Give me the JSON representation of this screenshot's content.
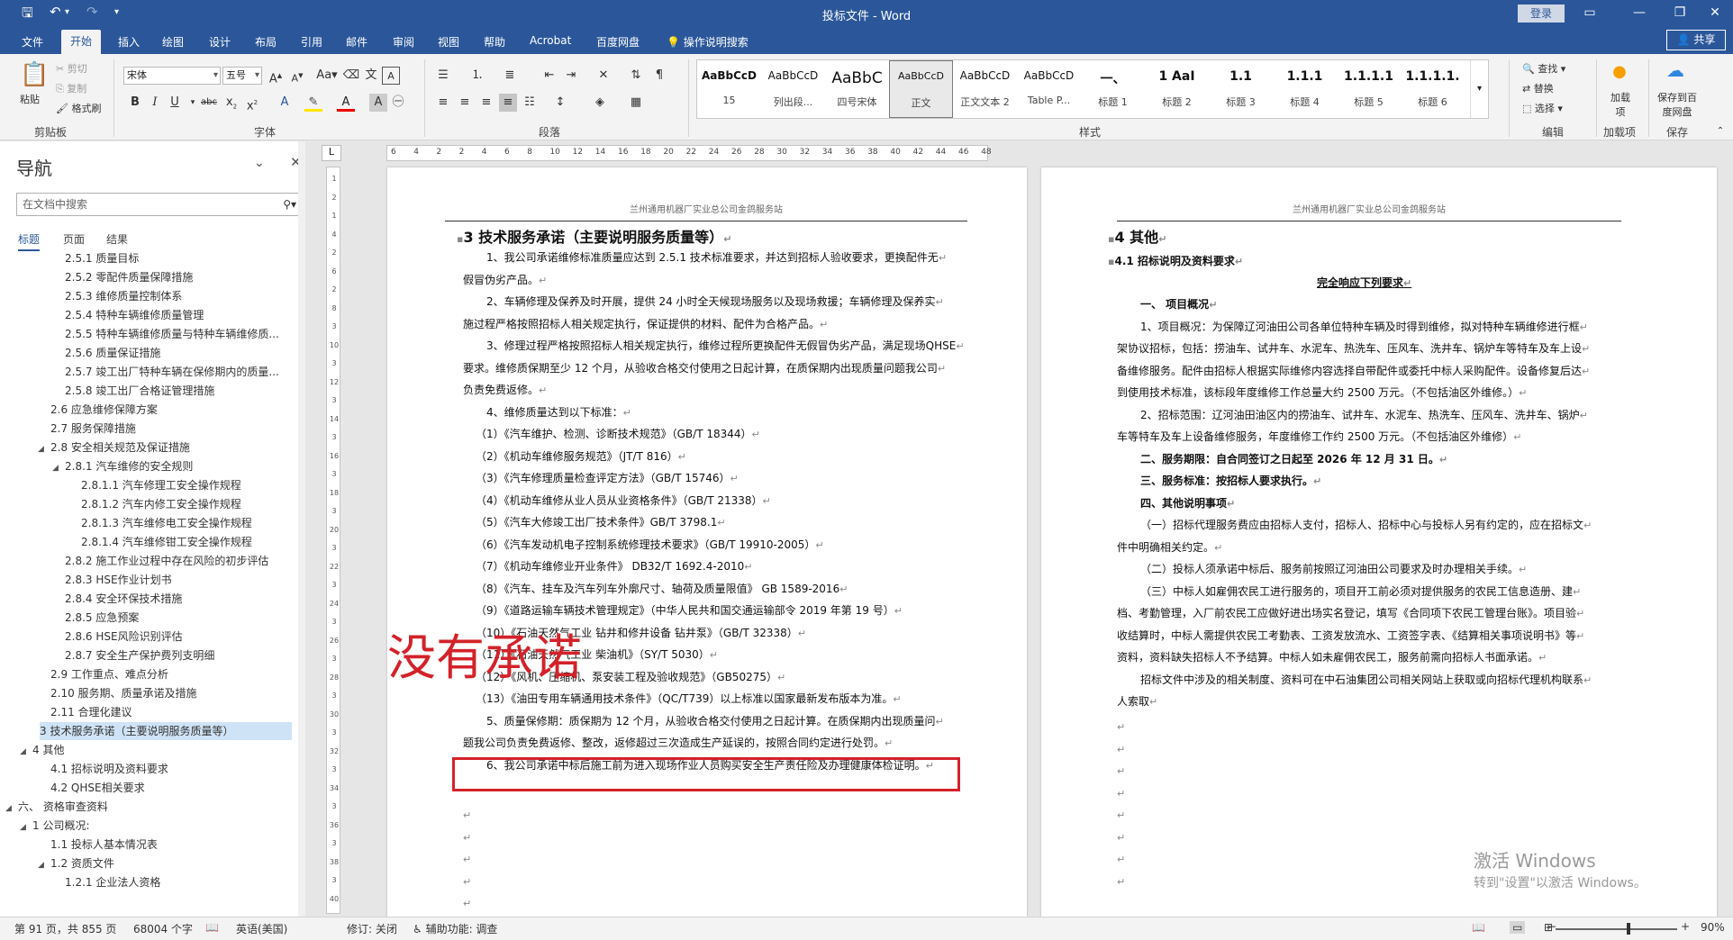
{
  "app": {
    "title": "投标文件  -  Word",
    "login": "登录",
    "share": "共享"
  },
  "tabs": [
    "文件",
    "开始",
    "插入",
    "绘图",
    "设计",
    "布局",
    "引用",
    "邮件",
    "审阅",
    "视图",
    "帮助",
    "Acrobat",
    "百度网盘"
  ],
  "tell_me": "操作说明搜索",
  "ribbon": {
    "clipboard": {
      "paste": "粘贴",
      "cut": "剪切",
      "copy": "复制",
      "format_painter": "格式刷",
      "label": "剪贴板"
    },
    "font": {
      "name": "宋体",
      "size": "五号",
      "label": "字体"
    },
    "paragraph": {
      "label": "段落"
    },
    "styles": {
      "label": "样式",
      "items": [
        {
          "preview": "AaBbCcD",
          "name": "15"
        },
        {
          "preview": "AaBbCcD",
          "name": "列出段..."
        },
        {
          "preview": "AaBbC",
          "name": "四号宋体"
        },
        {
          "preview": "AaBbCcD",
          "name": "正文"
        },
        {
          "preview": "AaBbCcD",
          "name": "正文文本 2"
        },
        {
          "preview": "AaBbCcD",
          "name": "Table P..."
        },
        {
          "preview": "一、",
          "name": "标题 1"
        },
        {
          "preview": "1  AaI",
          "name": "标题 2"
        },
        {
          "preview": "1.1",
          "name": "标题 3"
        },
        {
          "preview": "1.1.1",
          "name": "标题 4"
        },
        {
          "preview": "1.1.1.1",
          "name": "标题 5"
        },
        {
          "preview": "1.1.1.1.",
          "name": "标题 6"
        }
      ]
    },
    "editing": {
      "find": "查找",
      "replace": "替换",
      "select": "选择",
      "label": "编辑"
    },
    "addins": {
      "load": "加载项",
      "label": "加载项"
    },
    "save": {
      "save": "保存到百度网盘",
      "label": "保存"
    }
  },
  "nav": {
    "title": "导航",
    "search_placeholder": "在文档中搜索",
    "tabs": [
      "标题",
      "页面",
      "结果"
    ],
    "items": [
      {
        "text": "2.5.1 质量目标",
        "level": 3,
        "tri": ""
      },
      {
        "text": "2.5.2 零配件质量保障措施",
        "level": 3,
        "tri": ""
      },
      {
        "text": "2.5.3 维修质量控制体系",
        "level": 3,
        "tri": ""
      },
      {
        "text": "2.5.4 特种车辆维修质量管理",
        "level": 3,
        "tri": ""
      },
      {
        "text": "2.5.5 特种车辆维修质量与特种车辆维修质...",
        "level": 3,
        "tri": ""
      },
      {
        "text": "2.5.6 质量保证措施",
        "level": 3,
        "tri": ""
      },
      {
        "text": "2.5.7 竣工出厂特种车辆在保修期内的质量...",
        "level": 3,
        "tri": ""
      },
      {
        "text": "2.5.8 竣工出厂合格证管理措施",
        "level": 3,
        "tri": ""
      },
      {
        "text": "2.6 应急维修保障方案",
        "level": 2,
        "tri": ""
      },
      {
        "text": "2.7 服务保障措施",
        "level": 2,
        "tri": ""
      },
      {
        "text": "2.8 安全相关规范及保证措施",
        "level": 2,
        "tri": "◢"
      },
      {
        "text": "2.8.1 汽车维修的安全规则",
        "level": 3,
        "tri": "◢"
      },
      {
        "text": "2.8.1.1 汽车修理工安全操作规程",
        "level": 4,
        "tri": ""
      },
      {
        "text": "2.8.1.2 汽车内修工安全操作规程",
        "level": 4,
        "tri": ""
      },
      {
        "text": "2.8.1.3 汽车维修电工安全操作规程",
        "level": 4,
        "tri": ""
      },
      {
        "text": "2.8.1.4 汽车维修钳工安全操作规程",
        "level": 4,
        "tri": ""
      },
      {
        "text": "2.8.2 施工作业过程中存在风险的初步评估",
        "level": 3,
        "tri": ""
      },
      {
        "text": "2.8.3 HSE作业计划书",
        "level": 3,
        "tri": ""
      },
      {
        "text": "2.8.4 安全环保技术措施",
        "level": 3,
        "tri": ""
      },
      {
        "text": "2.8.5 应急预案",
        "level": 3,
        "tri": ""
      },
      {
        "text": "2.8.6 HSE风险识别评估",
        "level": 3,
        "tri": ""
      },
      {
        "text": "2.8.7 安全生产保护费列支明细",
        "level": 3,
        "tri": ""
      },
      {
        "text": "2.9 工作重点、难点分析",
        "level": 2,
        "tri": ""
      },
      {
        "text": "2.10 服务期、质量承诺及措施",
        "level": 2,
        "tri": ""
      },
      {
        "text": "2.11 合理化建议",
        "level": 2,
        "tri": ""
      },
      {
        "text": "3 技术服务承诺（主要说明服务质量等）",
        "level": 1,
        "tri": "",
        "selected": true
      },
      {
        "text": "4 其他",
        "level": 1,
        "tri": "◢"
      },
      {
        "text": "4.1 招标说明及资料要求",
        "level": 2,
        "tri": ""
      },
      {
        "text": "4.2 QHSE相关要求",
        "level": 2,
        "tri": ""
      },
      {
        "text": "六、 资格审查资料",
        "level": 0,
        "tri": "◢"
      },
      {
        "text": "1 公司概况:",
        "level": 1,
        "tri": "◢"
      },
      {
        "text": "1.1 投标人基本情况表",
        "level": 2,
        "tri": ""
      },
      {
        "text": "1.2 资质文件",
        "level": 2,
        "tri": "◢"
      },
      {
        "text": "1.2.1 企业法人资格",
        "level": 3,
        "tri": ""
      }
    ]
  },
  "ruler_top": [
    "6",
    "4",
    "2",
    "2",
    "4",
    "6",
    "8",
    "10",
    "12",
    "14",
    "16",
    "18",
    "20",
    "22",
    "24",
    "26",
    "28",
    "30",
    "32",
    "34",
    "36",
    "38",
    "40",
    "42",
    "44",
    "46",
    "48"
  ],
  "ruler_left": [
    "1",
    "2",
    "1",
    "4",
    "2",
    "6",
    "2",
    "8",
    "3",
    "10",
    "3",
    "12",
    "3",
    "14",
    "3",
    "16",
    "3",
    "18",
    "3",
    "20",
    "3",
    "22",
    "3",
    "24",
    "3",
    "26",
    "3",
    "28",
    "3",
    "30",
    "3",
    "32",
    "3",
    "34",
    "3",
    "36",
    "3",
    "38",
    "3",
    "40"
  ],
  "page1": {
    "header": "兰州通用机器厂实业总公司金鸽服务站",
    "heading": "3 技术服务承诺（主要说明服务质量等）",
    "lines": [
      "1、我公司承诺维修标准质量应达到 2.5.1 技术标准要求，并达到招标人验收要求，更换配件无",
      "假冒伪劣产品。",
      "2、车辆修理及保养及时开展，提供 24 小时全天候现场服务以及现场救援；车辆修理及保养实",
      "施过程严格按照招标人相关规定执行，保证提供的材料、配件为合格产品。",
      "3、修理过程严格按照招标人相关规定执行，维修过程所更换配件无假冒伪劣产品，满足现场QHSE",
      "要求。维修质保期至少 12 个月，从验收合格交付使用之日起计算，在质保期内出现质量问题我公司",
      "负责免费返修。",
      "4、维修质量达到以下标准：",
      "（1）《汽车维护、检测、诊断技术规范》（GB/T 18344）",
      "（2）《机动车维修服务规范》（JT/T 816）",
      "（3）《汽车修理质量检查评定方法》（GB/T 15746）",
      "（4）《机动车维修从业人员从业资格条件》（GB/T 21338）",
      "（5）《汽车大修竣工出厂技术条件》GB/T 3798.1",
      "（6）《汽车发动机电子控制系统修理技术要求》（GB/T 19910-2005）",
      "（7）《机动车维修业开业条件》 DB32/T 1692.4-2010",
      "（8）《汽车、挂车及汽车列车外廓尺寸、轴荷及质量限值》 GB 1589-2016",
      "（9）《道路运输车辆技术管理规定》（中华人民共和国交通运输部令 2019 年第 19 号）",
      "（10）《石油天然气工业 钻井和修井设备 钻井泵》（GB/T 32338）",
      "（11）《石油天然气工业 柴油机》（SY/T 5030）",
      "（12）《风机、压缩机、泵安装工程及验收规范》（GB50275）",
      "（13）《油田专用车辆通用技术条件》（QC/T739）以上标准以国家最新发布版本为准。",
      "5、质量保修期：质保期为 12 个月，从验收合格交付使用之日起计算。在质保期内出现质量问",
      "题我公司负责免费返修、整改，返修超过三次造成生产延误的，按照合同约定进行处罚。",
      "6、我公司承诺中标后施工前为进入现场作业人员购买安全生产责任险及办理健康体检证明。"
    ],
    "annotation": "没有承诺"
  },
  "page2": {
    "header": "兰州通用机器厂实业总公司金鸽服务站",
    "heading": "4 其他",
    "subheading": "4.1    招标说明及资料要求",
    "center": "完全响应下列要求",
    "lines": [
      {
        "t": "一、 项目概况",
        "b": true
      },
      {
        "t": "1、项目概况：为保障辽河油田公司各单位特种车辆及时得到维修，拟对特种车辆维修进行框",
        "b": false
      },
      {
        "t": "架协议招标，包括：捞油车、试井车、水泥车、热洗车、压风车、洗井车、锅炉车等特车及车上设",
        "b": false
      },
      {
        "t": "备维修服务。配件由招标人根据实际维修内容选择自带配件或委托中标人采购配件。设备修复后达",
        "b": false
      },
      {
        "t": "到使用技术标准，该标段年度维修工作总量大约 2500 万元。（不包括油区外维修。）",
        "b": false
      },
      {
        "t": "2、招标范围：辽河油田油区内的捞油车、试井车、水泥车、热洗车、压风车、洗井车、锅炉",
        "b": false
      },
      {
        "t": "车等特车及车上设备维修服务，年度维修工作约 2500 万元。（不包括油区外维修）",
        "b": false
      },
      {
        "t": "二、服务期限：自合同签订之日起至 2026 年 12 月 31 日。",
        "b": true
      },
      {
        "t": "三、服务标准：按招标人要求执行。",
        "b": true
      },
      {
        "t": "四、其他说明事项",
        "b": true
      },
      {
        "t": "（一）招标代理服务费应由招标人支付，招标人、招标中心与投标人另有约定的，应在招标文",
        "b": false
      },
      {
        "t": "件中明确相关约定。",
        "b": false
      },
      {
        "t": "（二）投标人须承诺中标后、服务前按照辽河油田公司要求及时办理相关手续。",
        "b": false
      },
      {
        "t": "（三）中标人如雇佣农民工进行服务的，项目开工前必须对提供服务的农民工信息造册、建",
        "b": false
      },
      {
        "t": "档、考勤管理，入厂前农民工应做好进出场实名登记，填写《合同项下农民工管理台账》。项目验",
        "b": false
      },
      {
        "t": "收结算时，中标人需提供农民工考勤表、工资发放流水、工资签字表、《结算相关事项说明书》等",
        "b": false
      },
      {
        "t": "资料，资料缺失招标人不予结算。中标人如未雇佣农民工，服务前需向招标人书面承诺。",
        "b": false
      },
      {
        "t": "招标文件中涉及的相关制度、资料可在中石油集团公司相关网站上获取或向招标代理机构联系",
        "b": false
      },
      {
        "t": "人索取",
        "b": false
      }
    ]
  },
  "watermark": {
    "line1": "激活 Windows",
    "line2": "转到\"设置\"以激活 Windows。"
  },
  "status": {
    "page": "第 91 页，共 855 页",
    "words": "68004 个字",
    "lang": "英语(美国)",
    "track": "修订: 关闭",
    "access": "辅助功能: 调查",
    "zoom": "90%"
  }
}
